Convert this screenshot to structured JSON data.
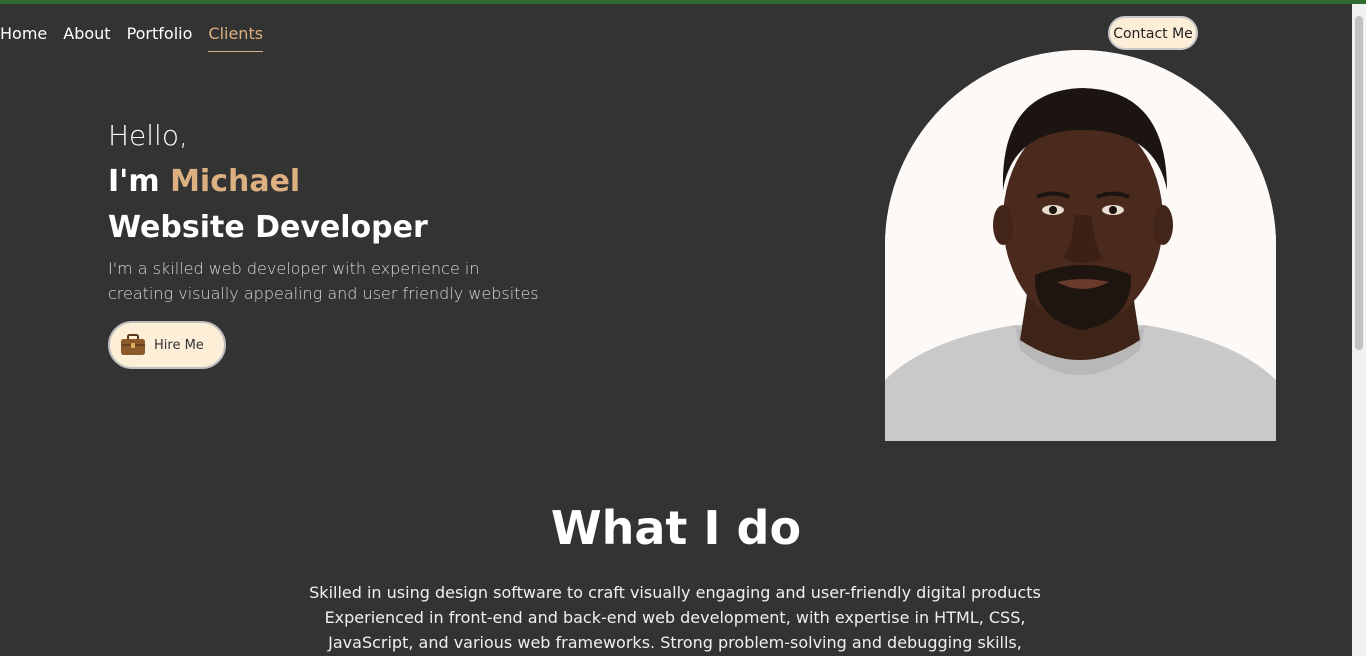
{
  "nav": {
    "items": [
      "Home",
      "About",
      "Portfolio",
      "Clients"
    ],
    "active": "Clients"
  },
  "contact_button": "Contact Me",
  "hero": {
    "greeting": "Hello,",
    "im_prefix": "I'm",
    "name": "Michael",
    "role": "Website Developer",
    "description": "I'm a skilled web developer with experience in creating visually appealing and user friendly websites",
    "hire_button": "Hire Me"
  },
  "section": {
    "title": "What I do",
    "text": "Skilled in using design software to craft visually engaging and user-friendly digital products Experienced in front-end and back-end web development, with expertise in HTML, CSS, JavaScript, and various web frameworks. Strong problem-solving and debugging skills,"
  },
  "colors": {
    "background": "#333333",
    "accent": "#dcb080",
    "button_bg": "#fdeed8",
    "topbar": "#2f6b2f"
  },
  "icons": {
    "hire": "briefcase-icon"
  }
}
